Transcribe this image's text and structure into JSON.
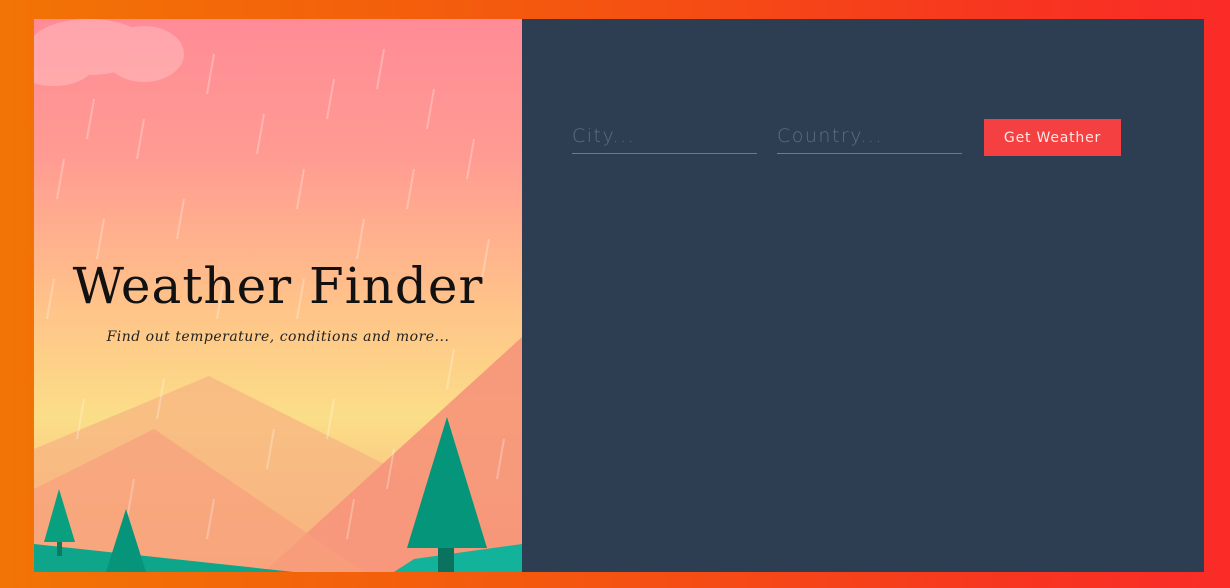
{
  "app": {
    "title": "Weather Finder",
    "subtitle": "Find out temperature, conditions and more..."
  },
  "form": {
    "city_placeholder": "City...",
    "country_placeholder": "Country...",
    "submit_label": "Get Weather"
  },
  "colors": {
    "border_gradient_start": "#f27405",
    "border_gradient_end": "#fa2b28",
    "panel_background": "#2e3e52",
    "accent": "#f44040",
    "tree": "#05957a"
  },
  "icons": [
    "cloud-icon",
    "rain-icon",
    "mountain-icon",
    "tree-icon"
  ]
}
